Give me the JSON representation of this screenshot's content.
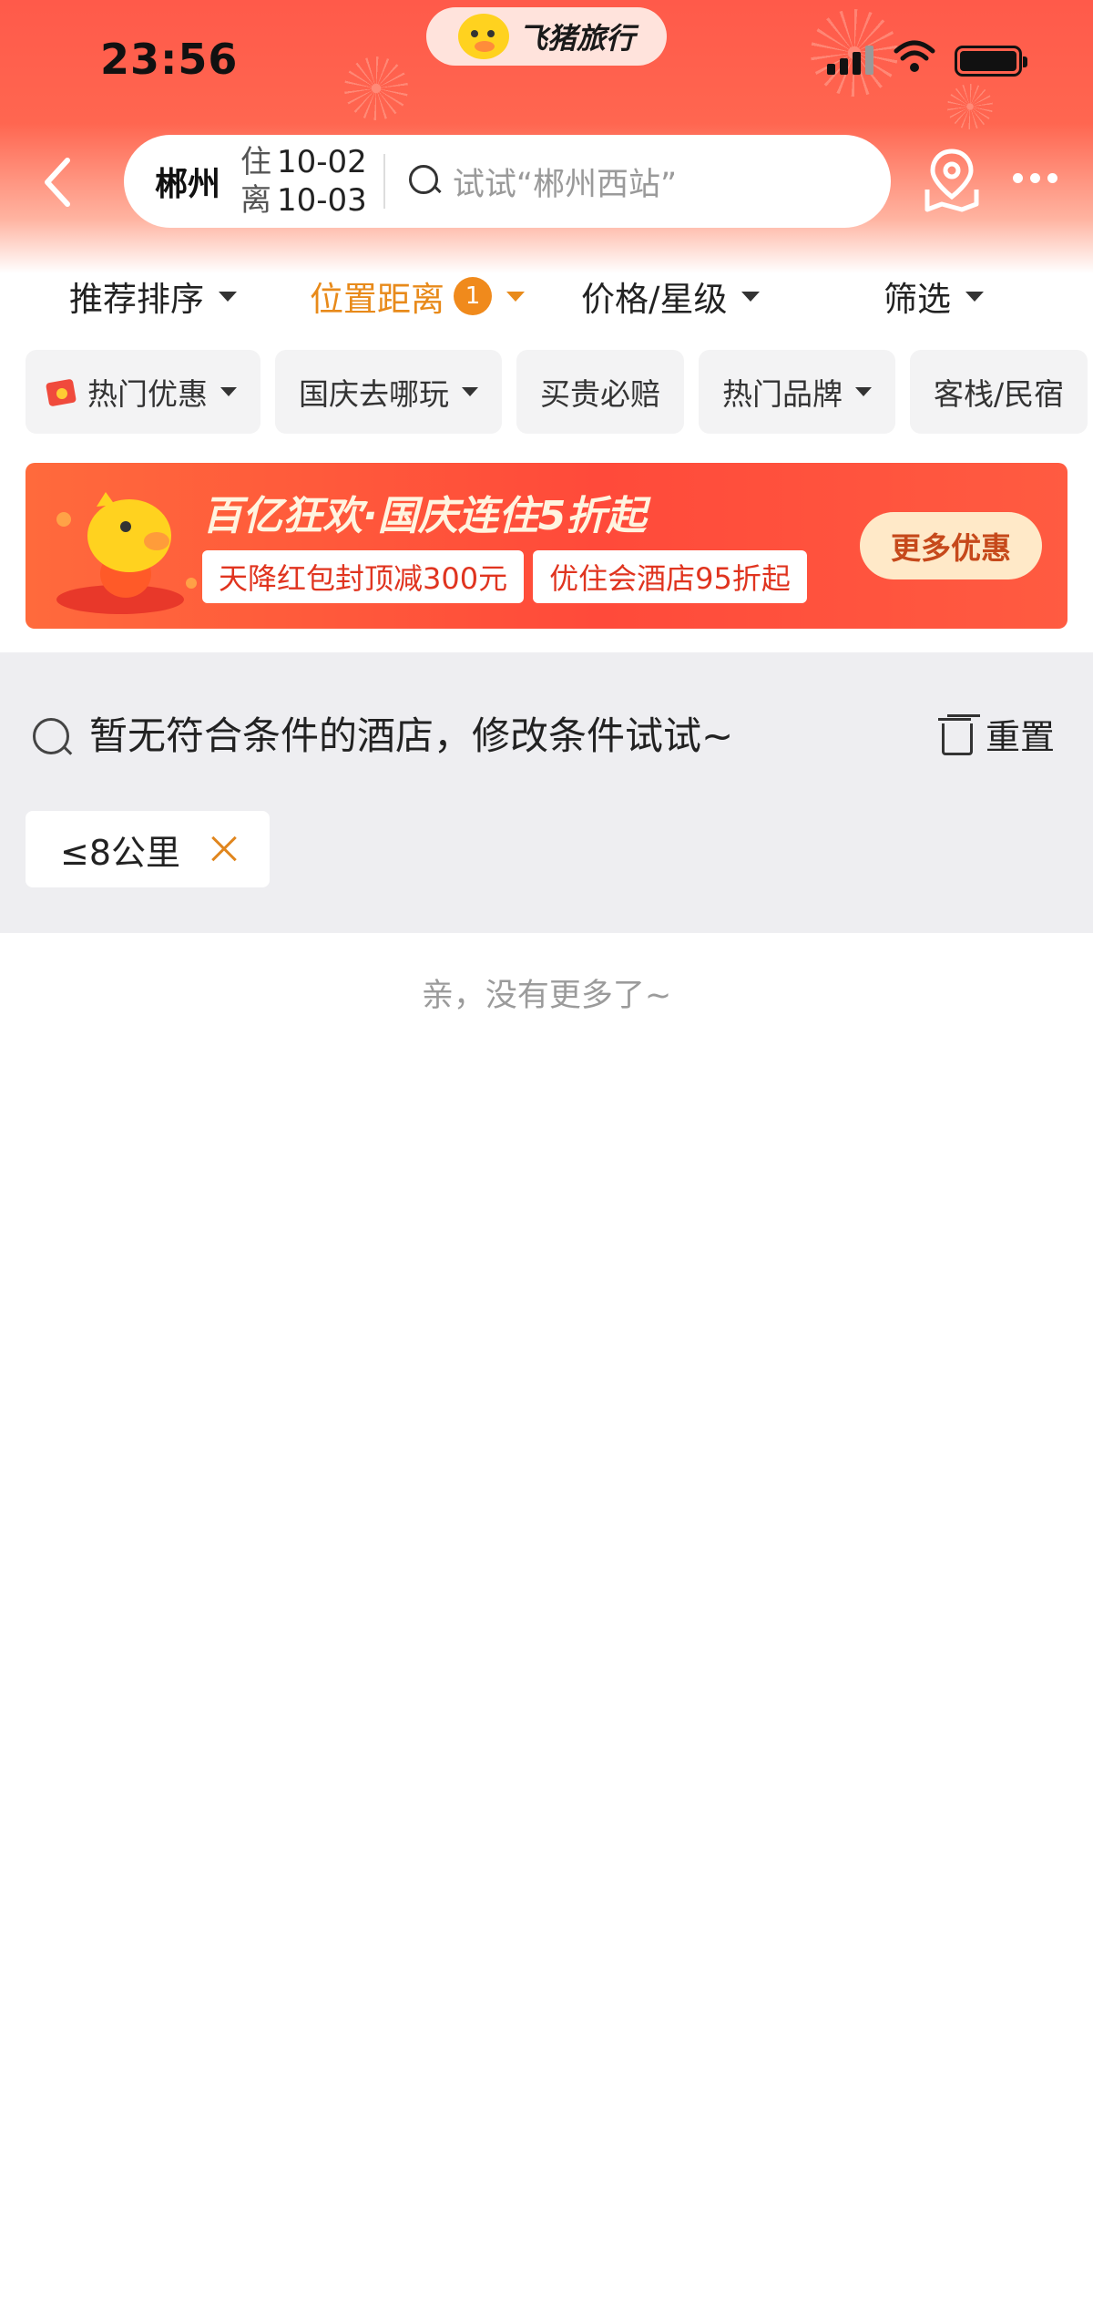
{
  "status_bar": {
    "time": "23:56"
  },
  "brand": {
    "name": "飞猪旅行"
  },
  "search": {
    "city": "郴州",
    "checkin_label": "住",
    "checkin_date": "10-02",
    "checkout_label": "离",
    "checkout_date": "10-03",
    "placeholder": "试试“郴州西站”"
  },
  "sort_tabs": [
    {
      "label": "推荐排序"
    },
    {
      "label": "位置距离",
      "badge": "1"
    },
    {
      "label": "价格/星级"
    },
    {
      "label": "筛选"
    }
  ],
  "chips": [
    {
      "label": "热门优惠"
    },
    {
      "label": "国庆去哪玩"
    },
    {
      "label": "买贵必赔"
    },
    {
      "label": "热门品牌"
    },
    {
      "label": "客栈/民宿"
    }
  ],
  "banner": {
    "title": "百亿狂欢·国庆连住5折起",
    "tags": [
      "天降红包封顶减300元",
      "优住会酒店95折起"
    ],
    "button": "更多优惠"
  },
  "empty_state": {
    "message": "暂无符合条件的酒店，修改条件试试~",
    "reset_label": "重置",
    "active_filter": "≤8公里"
  },
  "footer": {
    "no_more": "亲，没有更多了~"
  },
  "colors": {
    "accent": "#e88a1a",
    "header_red": "#ff5a4a",
    "banner_red": "#ff4a3a"
  }
}
